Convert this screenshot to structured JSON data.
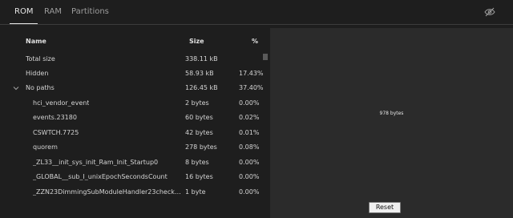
{
  "tabs": [
    "ROM",
    "RAM",
    "Partitions"
  ],
  "active_tab": "ROM",
  "toolbar": {
    "visibility_icon": "eye-off-icon"
  },
  "table": {
    "headers": {
      "name": "Name",
      "size": "Size",
      "pct": "%"
    },
    "rows": [
      {
        "name": "Total size",
        "size": "338.11 kB",
        "pct": "",
        "level": 0
      },
      {
        "name": "Hidden",
        "size": "58.93 kB",
        "pct": "17.43%",
        "level": 0
      },
      {
        "name": "No paths",
        "size": "126.45 kB",
        "pct": "37.40%",
        "level": 0,
        "expanded": true
      },
      {
        "name": "hci_vendor_event",
        "size": "2 bytes",
        "pct": "0.00%",
        "level": 1
      },
      {
        "name": "events.23180",
        "size": "60 bytes",
        "pct": "0.02%",
        "level": 1
      },
      {
        "name": "CSWTCH.7725",
        "size": "42 bytes",
        "pct": "0.01%",
        "level": 1
      },
      {
        "name": "quorem",
        "size": "278 bytes",
        "pct": "0.08%",
        "level": 1
      },
      {
        "name": "_ZL33__init_sys_init_Ram_Init_Startup0",
        "size": "8 bytes",
        "pct": "0.00%",
        "level": 1
      },
      {
        "name": "_GLOBAL__sub_I_unixEpochSecondsCount",
        "size": "16 bytes",
        "pct": "0.00%",
        "level": 1
      },
      {
        "name": "_ZZN23DimmingSubModuleHandler23checkAn...",
        "size": "1 byte",
        "pct": "0.00%",
        "level": 1
      }
    ]
  },
  "visualization": {
    "label": "978 bytes"
  },
  "reset_label": "Reset",
  "colors": {
    "background": "#1e1e1e",
    "panel": "#2b2b2b",
    "text": "#d4d4d4"
  }
}
